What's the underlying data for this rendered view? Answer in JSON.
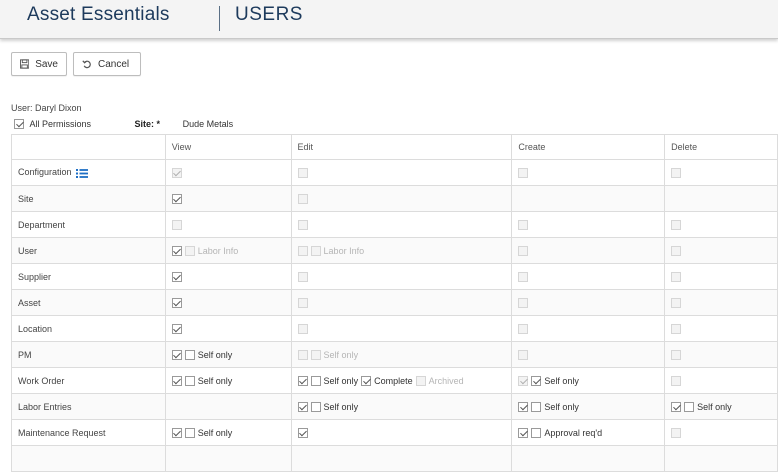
{
  "header": {
    "app_title": "Asset Essentials",
    "section_title": "USERS"
  },
  "toolbar": {
    "save_label": "Save",
    "cancel_label": "Cancel"
  },
  "user_line": "User: Daryl Dixon",
  "all_permissions": {
    "label": "All Permissions",
    "checked": true
  },
  "site": {
    "label": "Site: *",
    "value": "Dude Metals"
  },
  "columns": [
    "",
    "View",
    "Edit",
    "Create",
    "Delete"
  ],
  "colors": {
    "brand_text": "#1d3a5c",
    "icon_blue": "#1f6fc5"
  },
  "rows": [
    {
      "name": "Configuration",
      "icon": "list-icon",
      "cells": [
        [
          {
            "checked": true,
            "disabled": true
          }
        ],
        [
          {
            "checked": false,
            "disabled": true
          }
        ],
        [
          {
            "checked": false,
            "disabled": true
          }
        ],
        [
          {
            "checked": false,
            "disabled": true
          }
        ]
      ]
    },
    {
      "name": "Site",
      "cells": [
        [
          {
            "checked": true,
            "disabled": false
          }
        ],
        [
          {
            "checked": false,
            "disabled": true
          }
        ],
        [],
        []
      ]
    },
    {
      "name": "Department",
      "cells": [
        [
          {
            "checked": false,
            "disabled": true
          }
        ],
        [
          {
            "checked": false,
            "disabled": true
          }
        ],
        [
          {
            "checked": false,
            "disabled": true
          }
        ],
        [
          {
            "checked": false,
            "disabled": true
          }
        ]
      ]
    },
    {
      "name": "User",
      "cells": [
        [
          {
            "checked": true,
            "disabled": false
          },
          {
            "checked": false,
            "disabled": true,
            "label": "Labor Info"
          }
        ],
        [
          {
            "checked": false,
            "disabled": true
          },
          {
            "checked": false,
            "disabled": true,
            "label": "Labor Info"
          }
        ],
        [
          {
            "checked": false,
            "disabled": true
          }
        ],
        [
          {
            "checked": false,
            "disabled": true
          }
        ]
      ]
    },
    {
      "name": "Supplier",
      "cells": [
        [
          {
            "checked": true,
            "disabled": false
          }
        ],
        [
          {
            "checked": false,
            "disabled": true
          }
        ],
        [
          {
            "checked": false,
            "disabled": true
          }
        ],
        [
          {
            "checked": false,
            "disabled": true
          }
        ]
      ]
    },
    {
      "name": "Asset",
      "cells": [
        [
          {
            "checked": true,
            "disabled": false
          }
        ],
        [
          {
            "checked": false,
            "disabled": true
          }
        ],
        [
          {
            "checked": false,
            "disabled": true
          }
        ],
        [
          {
            "checked": false,
            "disabled": true
          }
        ]
      ]
    },
    {
      "name": "Location",
      "cells": [
        [
          {
            "checked": true,
            "disabled": false
          }
        ],
        [
          {
            "checked": false,
            "disabled": true
          }
        ],
        [
          {
            "checked": false,
            "disabled": true
          }
        ],
        [
          {
            "checked": false,
            "disabled": true
          }
        ]
      ]
    },
    {
      "name": "PM",
      "cells": [
        [
          {
            "checked": true,
            "disabled": false
          },
          {
            "checked": false,
            "disabled": false,
            "label": "Self only"
          }
        ],
        [
          {
            "checked": false,
            "disabled": true
          },
          {
            "checked": false,
            "disabled": true,
            "label": "Self only"
          }
        ],
        [
          {
            "checked": false,
            "disabled": true
          }
        ],
        [
          {
            "checked": false,
            "disabled": true
          }
        ]
      ]
    },
    {
      "name": "Work Order",
      "cells": [
        [
          {
            "checked": true,
            "disabled": false
          },
          {
            "checked": false,
            "disabled": false,
            "label": "Self only"
          }
        ],
        [
          {
            "checked": true,
            "disabled": false
          },
          {
            "checked": false,
            "disabled": false,
            "label": "Self only"
          },
          {
            "checked": true,
            "disabled": false,
            "label": "Complete"
          },
          {
            "checked": false,
            "disabled": true,
            "label": "Archived"
          }
        ],
        [
          {
            "checked": true,
            "disabled": true
          },
          {
            "checked": true,
            "disabled": false,
            "label": "Self only"
          }
        ],
        [
          {
            "checked": false,
            "disabled": true
          }
        ]
      ]
    },
    {
      "name": "Labor Entries",
      "cells": [
        [],
        [
          {
            "checked": true,
            "disabled": false
          },
          {
            "checked": false,
            "disabled": false,
            "label": "Self only"
          }
        ],
        [
          {
            "checked": true,
            "disabled": false
          },
          {
            "checked": false,
            "disabled": false,
            "label": "Self only"
          }
        ],
        [
          {
            "checked": true,
            "disabled": false
          },
          {
            "checked": false,
            "disabled": false,
            "label": "Self only"
          }
        ]
      ]
    },
    {
      "name": "Maintenance Request",
      "cells": [
        [
          {
            "checked": true,
            "disabled": false
          },
          {
            "checked": false,
            "disabled": false,
            "label": "Self only"
          }
        ],
        [
          {
            "checked": true,
            "disabled": false
          }
        ],
        [
          {
            "checked": true,
            "disabled": false
          },
          {
            "checked": false,
            "disabled": false,
            "label": "Approval req'd"
          }
        ],
        [
          {
            "checked": false,
            "disabled": true
          }
        ]
      ]
    },
    {
      "name": "",
      "cells": [
        [],
        [],
        [],
        []
      ]
    }
  ]
}
